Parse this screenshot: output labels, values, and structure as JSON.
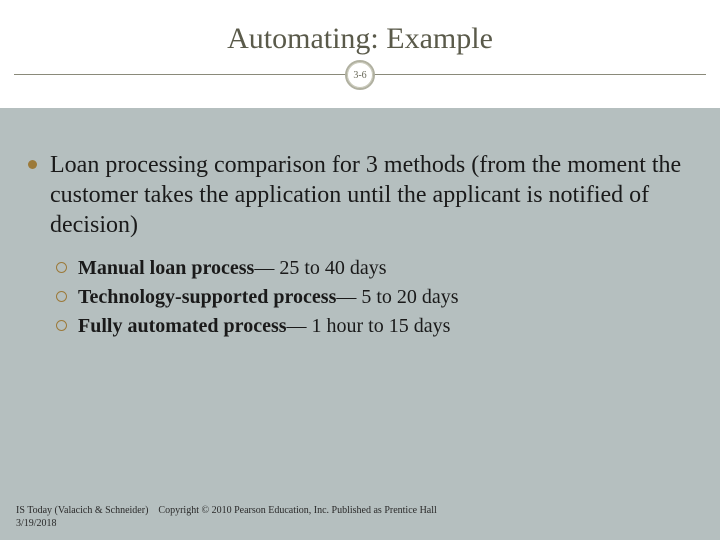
{
  "title": "Automating: Example",
  "slide_number": "3-6",
  "main_bullet": "Loan processing comparison for 3 methods (from the moment the customer takes the application until the applicant is notified of decision)",
  "sub_items": [
    {
      "bold": "Manual loan process",
      "rest": "— 25 to 40 days"
    },
    {
      "bold": "Technology-supported process",
      "rest": "— 5 to 20 days"
    },
    {
      "bold": "Fully automated process",
      "rest": "— 1 hour to 15 days"
    }
  ],
  "footer": {
    "source": "IS Today (Valacich & Schneider)",
    "copyright": "Copyright © 2010 Pearson Education, Inc. Published as Prentice Hall",
    "date": "3/19/2018"
  }
}
